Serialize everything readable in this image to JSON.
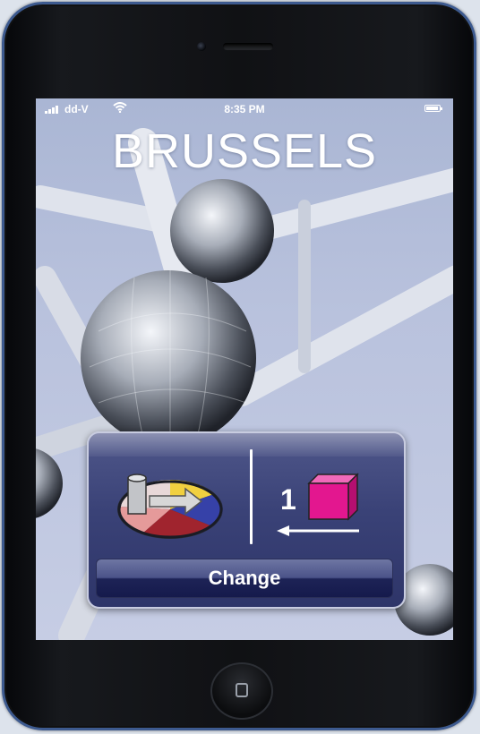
{
  "status_bar": {
    "carrier": "dd-V",
    "time": "8:35 PM",
    "signal_bars": 4,
    "battery_level": 0.9
  },
  "screen": {
    "title": "BRUSSELS",
    "background_image": "atomium-photo"
  },
  "panel": {
    "diagram_icon": "pie-cylinder-arrow-icon",
    "count": "1",
    "cube_icon": "magenta-cube-icon",
    "arrow_icon": "left-arrow-icon",
    "change_label": "Change"
  },
  "colors": {
    "frame_blue": "#3d5a8f",
    "panel_top": "#4f578a",
    "panel_bottom": "#2e3569",
    "cube_magenta": "#e3178f",
    "pie_yellow": "#f1d040",
    "pie_blue": "#3641a8",
    "pie_red": "#a0242e",
    "pie_pink": "#e59a9a"
  }
}
